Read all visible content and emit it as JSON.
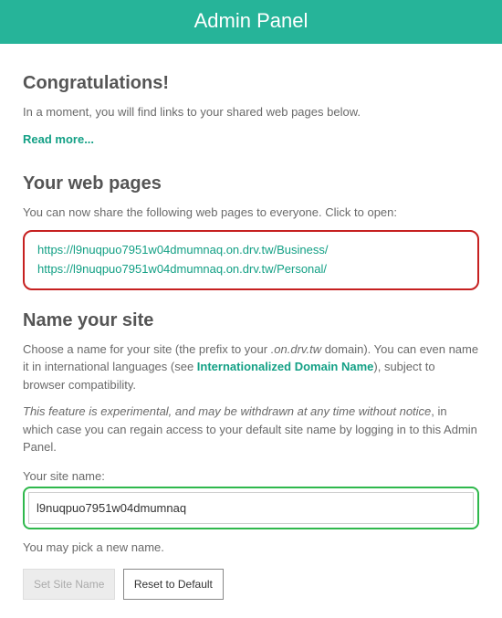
{
  "header": {
    "title": "Admin Panel"
  },
  "section1": {
    "heading": "Congratulations!",
    "text": "In a moment, you will find links to your shared web pages below.",
    "readmore": "Read more..."
  },
  "section2": {
    "heading": "Your web pages",
    "text": "You can now share the following web pages to everyone. Click to open:",
    "links": [
      "https://l9nuqpuo7951w04dmumnaq.on.drv.tw/Business/",
      "https://l9nuqpuo7951w04dmumnaq.on.drv.tw/Personal/"
    ]
  },
  "section3": {
    "heading": "Name your site",
    "para1_a": "Choose a name for your site (the prefix to your ",
    "para1_domain": ".on.drv.tw",
    "para1_b": " domain). You can even name it in international languages (see ",
    "idn_label": "Internationalized Domain Name",
    "para1_c": "), subject to browser compatibility.",
    "para2_a": "This feature is experimental, and may be withdrawn at any time without notice",
    "para2_b": ", in which case you can regain access to your default site name by logging in to this Admin Panel.",
    "label": "Your site name:",
    "input_value": "l9nuqpuo7951w04dmumnaq",
    "helper": "You may pick a new name.",
    "btn_set": "Set Site Name",
    "btn_reset": "Reset to Default"
  }
}
